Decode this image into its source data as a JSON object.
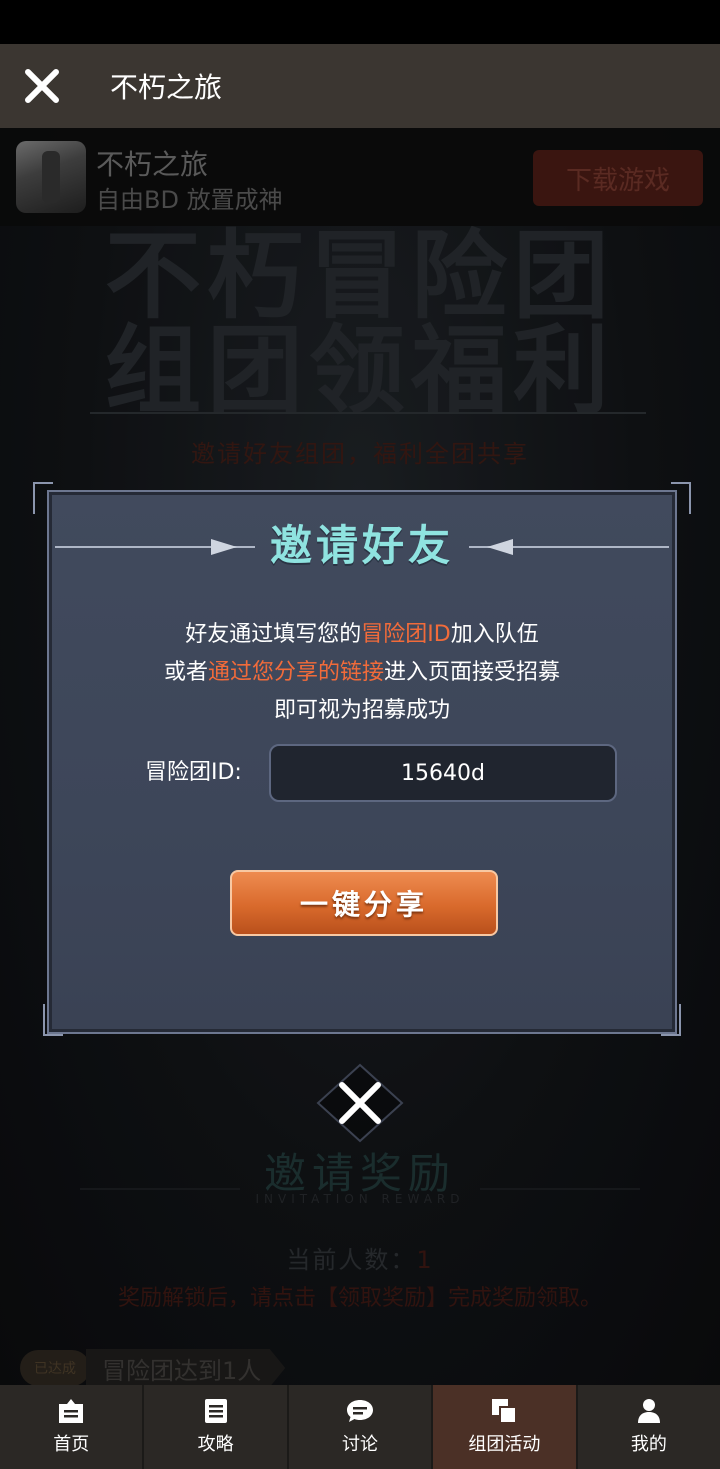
{
  "nav": {
    "title": "不朽之旅"
  },
  "background": {
    "title_line1": "不朽冒险团",
    "title_line2": "组团领福利",
    "subtitle": "邀请好友组团，福利全团共享",
    "reward_title": "邀请奖励",
    "reward_subtitle": "INVITATION REWARD",
    "count_label": "当前人数：",
    "count_value": "1",
    "hint": "奖励解锁后，请点击【领取奖励】完成奖励领取。",
    "task_badge": "已达成",
    "task_label": "冒险团达到1人"
  },
  "ad": {
    "app_name": "不朽之旅",
    "slogan": "自由BD 放置成神",
    "download_label": "下载游戏"
  },
  "modal": {
    "title": "邀请好友",
    "line1_pre": "好友通过填写您的",
    "line1_hl": "冒险团ID",
    "line1_post": "加入队伍",
    "line2_pre": "或者",
    "line2_hl": "通过您分享的链接",
    "line2_post": "进入页面接受招募",
    "line3": "即可视为招募成功",
    "id_label": "冒险团ID:",
    "id_value": "15640d",
    "share_label": "一键分享"
  },
  "tabs": [
    {
      "label": "首页",
      "icon": "home-icon"
    },
    {
      "label": "攻略",
      "icon": "document-icon"
    },
    {
      "label": "讨论",
      "icon": "chat-icon"
    },
    {
      "label": "组团活动",
      "icon": "copy-icon"
    },
    {
      "label": "我的",
      "icon": "person-icon"
    }
  ],
  "colors": {
    "accent": "#f26b3a",
    "modal_title": "#8fe3e0",
    "active_tab": "#4b3026"
  }
}
